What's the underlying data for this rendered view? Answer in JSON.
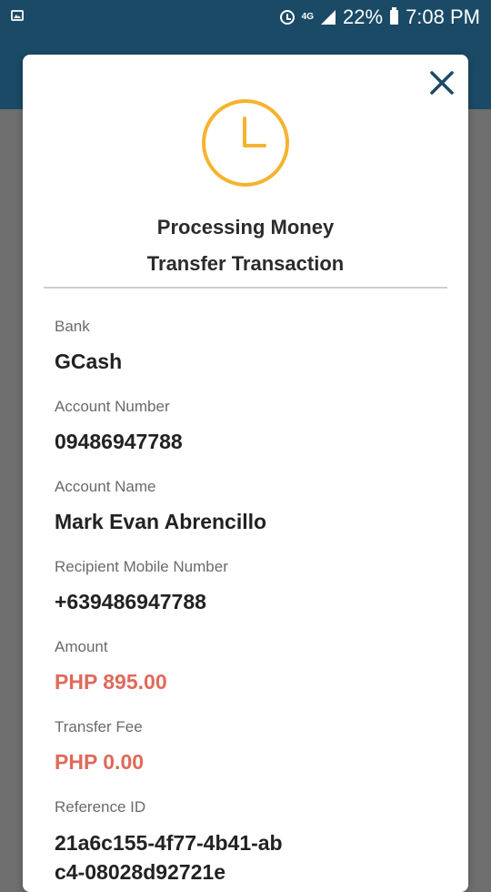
{
  "status_bar": {
    "network": "4G",
    "battery": "22%",
    "time": "7:08 PM"
  },
  "modal": {
    "title_line1": "Processing Money",
    "title_line2": "Transfer Transaction",
    "fields": [
      {
        "label": "Bank",
        "value": "GCash"
      },
      {
        "label": "Account Number",
        "value": "09486947788"
      },
      {
        "label": "Account Name",
        "value": "Mark Evan Abrencillo"
      },
      {
        "label": "Recipient Mobile Number",
        "value": "+639486947788"
      },
      {
        "label": "Amount",
        "value": "PHP 895.00"
      },
      {
        "label": "Transfer Fee",
        "value": "PHP 0.00"
      },
      {
        "label": "Reference ID",
        "value": "21a6c155-4f77-4b41-abc4-08028d92721e"
      }
    ]
  },
  "colors": {
    "accent_clock": "#f5b32f",
    "money": "#e0695a",
    "header": "#1a4a66"
  },
  "icons": {
    "status_image": "image-icon",
    "alarm": "alarm-icon",
    "signal": "signal-icon",
    "battery": "battery-icon",
    "close": "close-icon",
    "clock": "clock-icon"
  }
}
